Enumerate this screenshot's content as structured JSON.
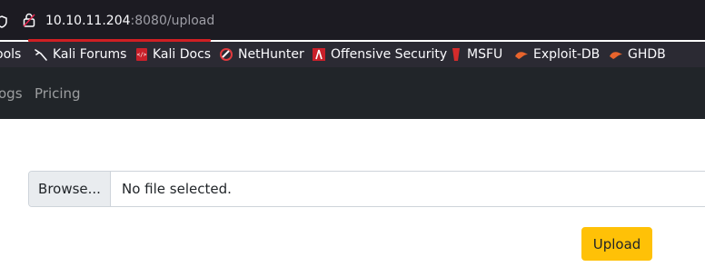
{
  "browser": {
    "url_host": "10.10.11.204",
    "url_path": ":8080/upload",
    "accent": "#d01f23"
  },
  "bookmarks": [
    {
      "label": "ools",
      "icon": "none"
    },
    {
      "label": "Kali Forums",
      "icon": "kali-dragon-icon"
    },
    {
      "label": "Kali Docs",
      "icon": "kali-docs-icon"
    },
    {
      "label": "NetHunter",
      "icon": "nethunter-icon"
    },
    {
      "label": "Offensive Security",
      "icon": "offsec-icon"
    },
    {
      "label": "MSFU",
      "icon": "msfu-icon"
    },
    {
      "label": "Exploit-DB",
      "icon": "exploit-db-icon"
    },
    {
      "label": "GHDB",
      "icon": "ghdb-icon"
    }
  ],
  "navbar": {
    "links": [
      {
        "label": "ogs"
      },
      {
        "label": "Pricing"
      }
    ]
  },
  "upload_form": {
    "browse_label": "Browse...",
    "file_status": "No file selected.",
    "submit_label": "Upload",
    "submit_color": "#ffc107"
  }
}
